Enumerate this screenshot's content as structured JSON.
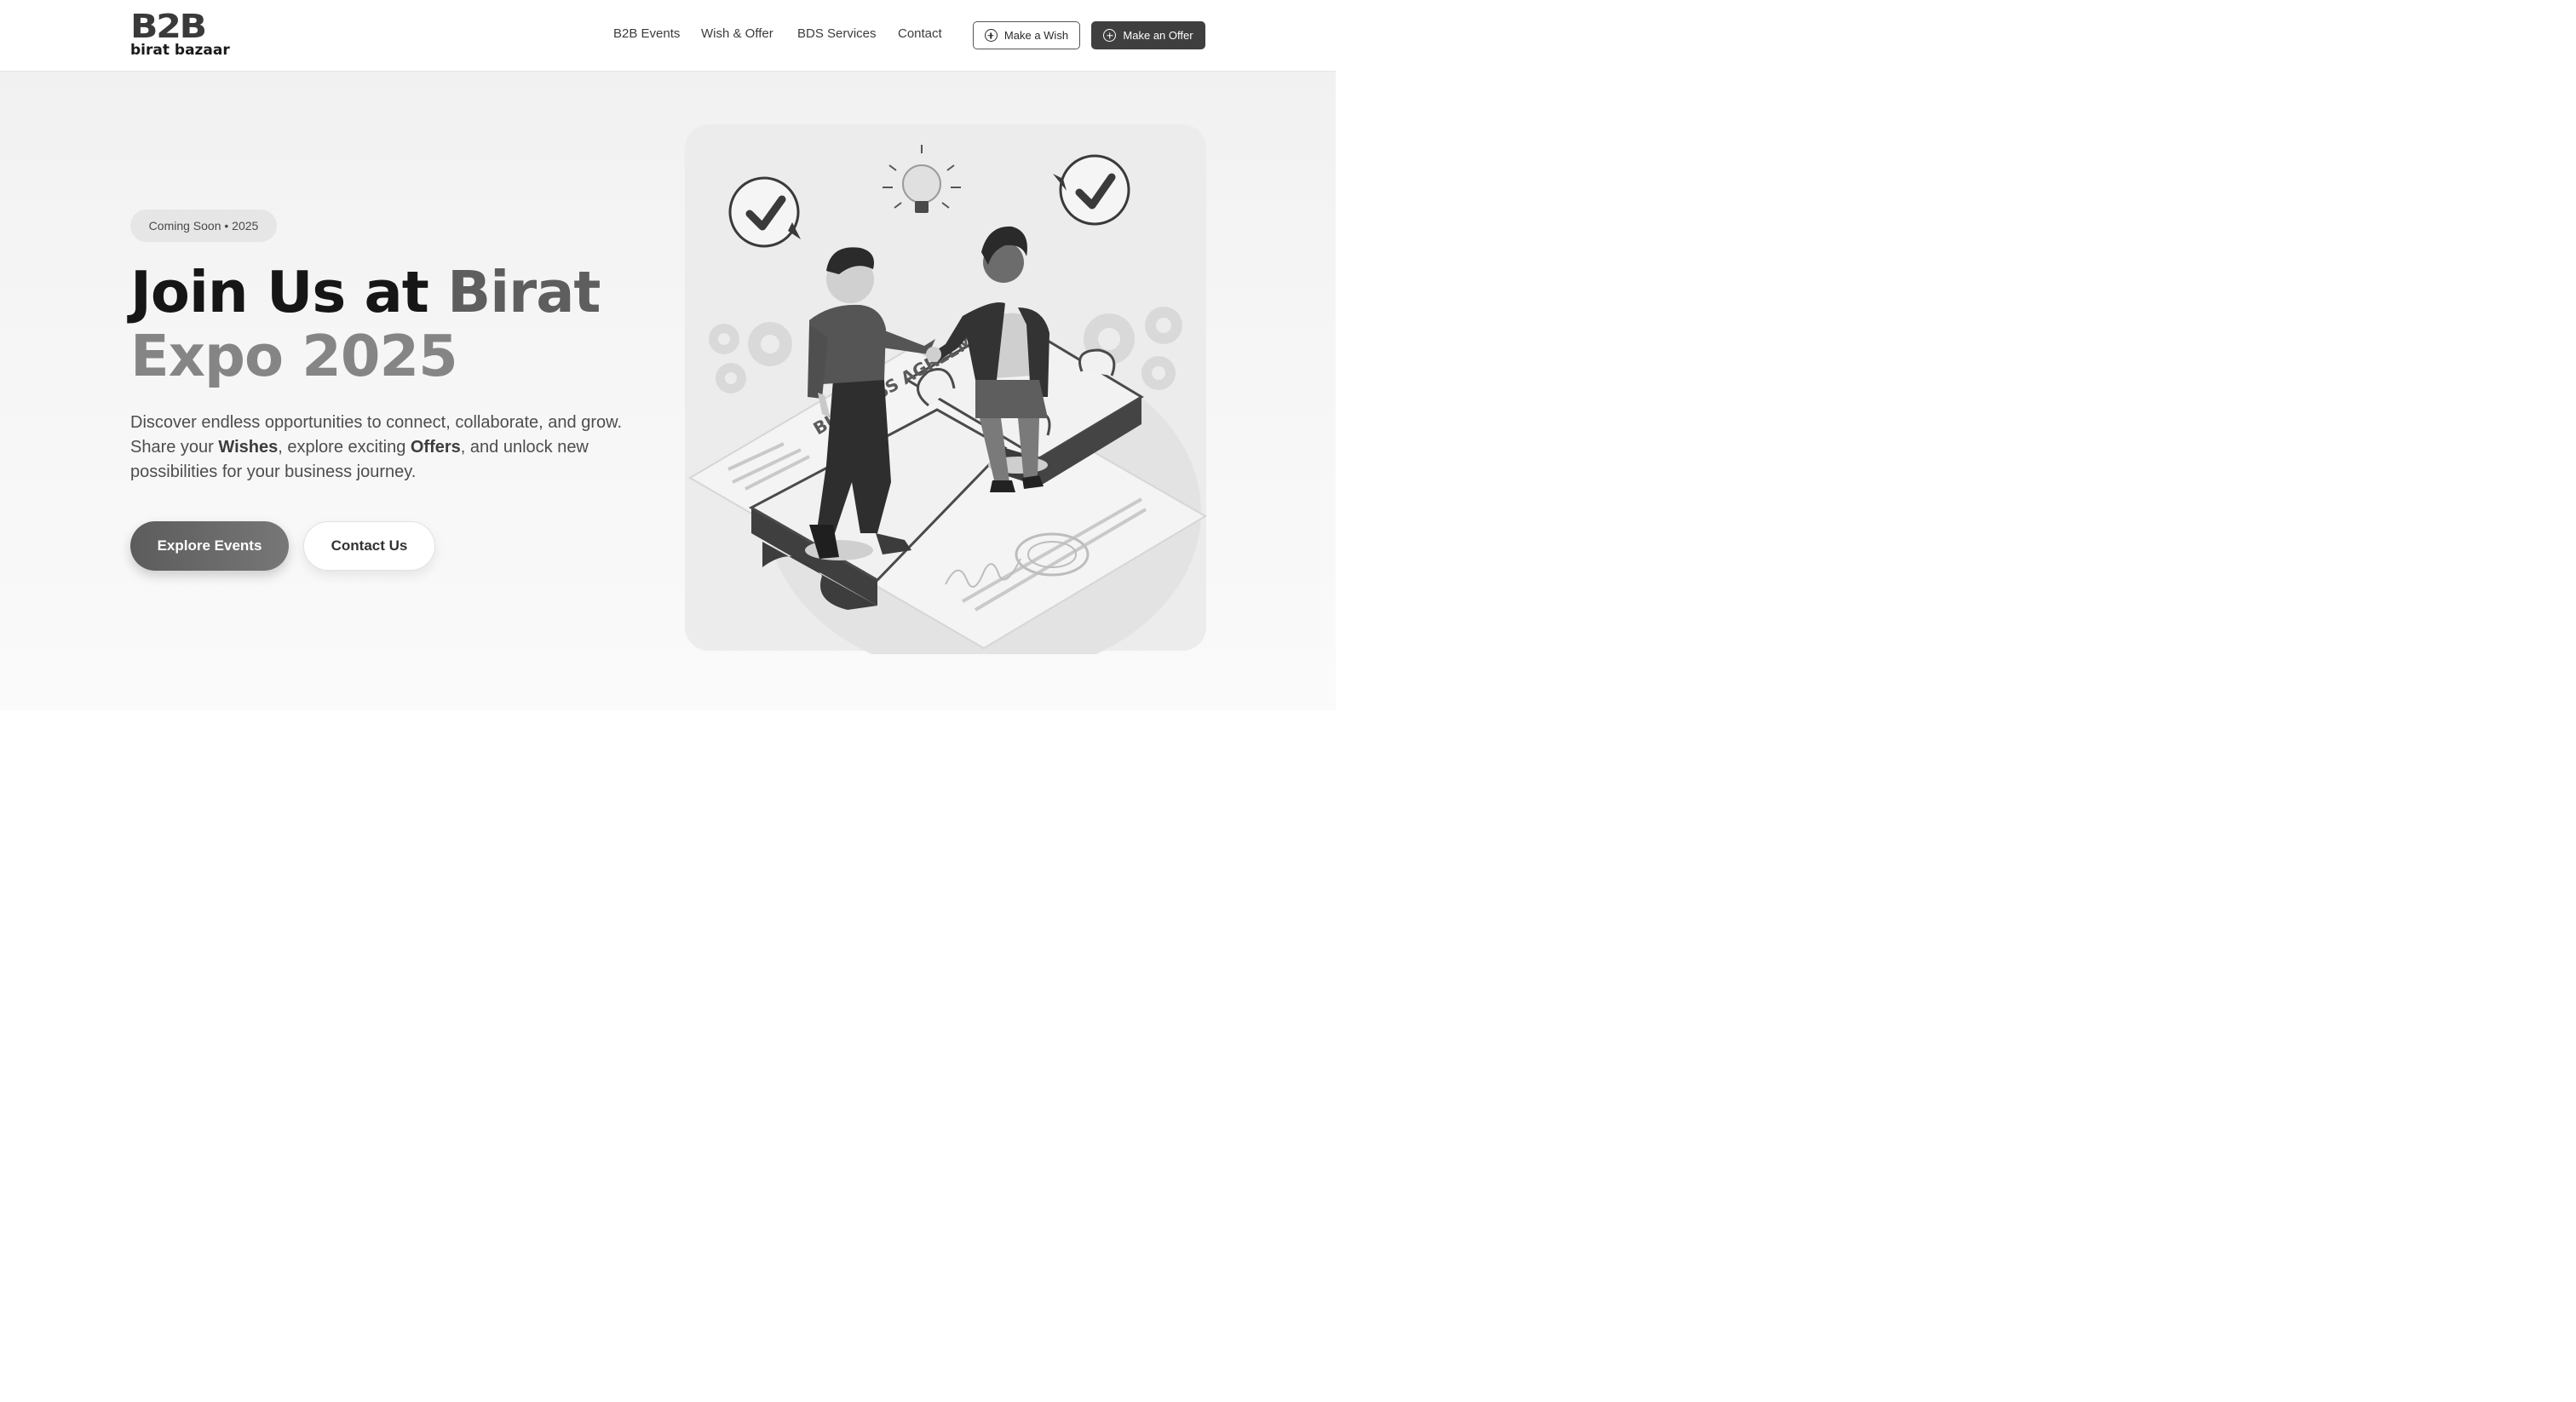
{
  "brand": {
    "logo_mark": "B2B",
    "logo_text": "birat bazaar"
  },
  "nav": {
    "items": [
      {
        "label": "B2B Events"
      },
      {
        "label": "Wish & Offer"
      },
      {
        "label": "BDS Services"
      },
      {
        "label": "Contact"
      }
    ],
    "make_wish": "Make a Wish",
    "make_offer": "Make an Offer"
  },
  "hero": {
    "badge": "Coming Soon • 2025",
    "headline_part1": "Join Us at ",
    "headline_part2": "Birat",
    "headline_part3": "Expo 2025",
    "desc_1": "Discover endless opportunities to connect, collaborate, and grow. Share your ",
    "desc_wishes": "Wishes",
    "desc_2": ", explore exciting ",
    "desc_offers": "Offers",
    "desc_3": ", and unlock new possibilities for your business journey.",
    "explore_label": "Explore Events",
    "contact_label": "Contact Us",
    "illustration": {
      "puzzle_text": "BUSINESS AGREEMENT"
    }
  },
  "colors": {
    "primary_button": "#3f3f3f",
    "heading_dark": "#161616",
    "heading_mid": "#5e5e5e",
    "heading_light": "#858585"
  }
}
